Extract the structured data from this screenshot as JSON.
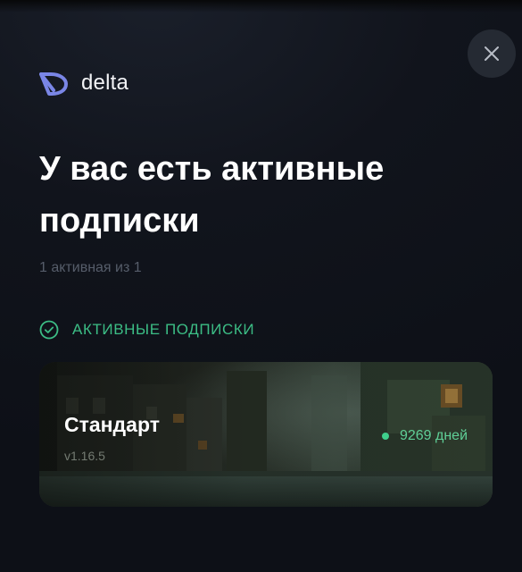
{
  "brand": {
    "name": "delta",
    "logo_icon": "delta-logo-icon",
    "logo_color": "#7a86e6"
  },
  "header": {
    "title": "У вас есть активные подписки",
    "subtitle": "1 активная из 1"
  },
  "close_button": {
    "icon": "close-icon"
  },
  "section": {
    "label": "АКТИВНЫЕ ПОДПИСКИ",
    "icon": "check-circle-icon",
    "accent_color": "#3cbd85"
  },
  "subscriptions": [
    {
      "name": "Стандарт",
      "version": "v1.16.5",
      "days": "9269 дней",
      "status_color": "#3fcf8c"
    }
  ]
}
